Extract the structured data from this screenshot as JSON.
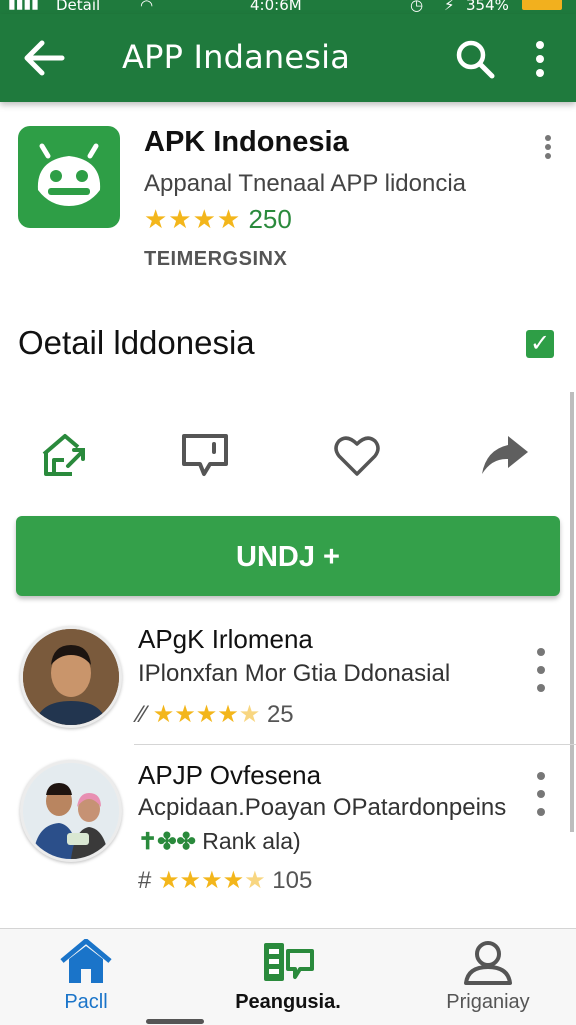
{
  "status_bar": {
    "carrier": "Detail",
    "time": "4:0:6M",
    "battery": "354%"
  },
  "app_bar": {
    "title": "APP Indanesia",
    "back_icon": "arrow-left-icon",
    "search_icon": "search-icon",
    "more_icon": "more-vert-icon"
  },
  "app_header": {
    "name": "APK Indonesia",
    "subtitle": "Appanal Tnenaal APP lidoncia",
    "stars": "★★★★",
    "rating_count": "250",
    "developer": "TEIMERGSINX"
  },
  "section": {
    "title": "Oetail lddonesia",
    "checked": true
  },
  "actions": [
    "home-share-icon",
    "comment-icon",
    "heart-icon",
    "share-arrow-icon"
  ],
  "install_button": {
    "label": "UNDJ +"
  },
  "list": [
    {
      "title": "APgK Irlomena",
      "subtitle": "IPlonxfan Mor Gtia  Ddonasial",
      "rate_prefix": "⁄⁄",
      "stars": "★★★★",
      "half": "★",
      "count": "25"
    },
    {
      "title": "APJP Ovfesena",
      "subtitle": "Acpidaan.Poayan OPatardonpeins",
      "tag_prefix": "✝✤✤",
      "tag": "Rank ala)",
      "rate_prefix": "#",
      "stars": "★★★★",
      "half": "★",
      "count": "105"
    }
  ],
  "bottom_nav": [
    {
      "label": "Pacll",
      "icon": "home-icon",
      "color": "#1a74c9"
    },
    {
      "label": "Peangusia.",
      "icon": "apps-icon",
      "color": "#111111"
    },
    {
      "label": "Priganiay",
      "icon": "person-icon",
      "color": "#555555"
    }
  ],
  "colors": {
    "primary": "#1f7a3d",
    "accent": "#34a04a",
    "star": "#f3b61b"
  }
}
